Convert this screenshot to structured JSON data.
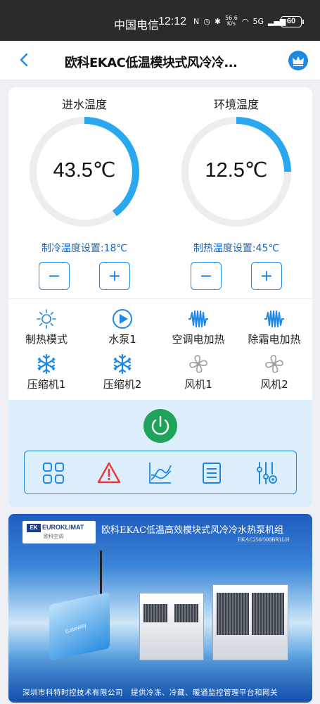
{
  "status_bar": {
    "carrier": "中国电信",
    "time": "12:12",
    "net_speed_value": "56.6",
    "net_speed_unit": "K/s",
    "signal_type": "5G",
    "battery": "60"
  },
  "header": {
    "title": "欧科EKAC低温模块式风冷冷..."
  },
  "gauges": [
    {
      "label": "进水温度",
      "value": "43.5℃",
      "fill_fraction": 0.4,
      "setting": "制冷温度设置:18℃"
    },
    {
      "label": "环境温度",
      "value": "12.5℃",
      "fill_fraction": 0.25,
      "setting": "制热温度设置:45℃"
    }
  ],
  "stepper": {
    "minus": "−",
    "plus": "+"
  },
  "statuses": [
    {
      "label": "制热模式",
      "icon": "sun-icon",
      "active": true
    },
    {
      "label": "水泵1",
      "icon": "pump-icon",
      "active": true
    },
    {
      "label": "空调电加热",
      "icon": "electric-heater-icon",
      "active": true
    },
    {
      "label": "除霜电加热",
      "icon": "electric-heater-icon",
      "active": true
    },
    {
      "label": "压缩机1",
      "icon": "snowflake-icon",
      "active": true
    },
    {
      "label": "压缩机2",
      "icon": "snowflake-icon",
      "active": true
    },
    {
      "label": "风机1",
      "icon": "fan-icon",
      "active": false
    },
    {
      "label": "风机2",
      "icon": "fan-icon",
      "active": false
    }
  ],
  "toolbar": {
    "items": [
      "grid-icon",
      "alarm-icon",
      "trend-chart-icon",
      "list-icon",
      "settings-sliders-icon"
    ]
  },
  "colors": {
    "accent": "#1e88e5",
    "gauge_track": "#ededed",
    "power": "#1fa35a",
    "alarm": "#e53935",
    "inactive": "#9e9e9e"
  },
  "banner": {
    "logo_text": "EUROKLIMAT",
    "logo_abbr": "EK",
    "logo_cn": "欧科空调",
    "headline": "欧科EKAC低温高效模块式风冷冷水热泵机组",
    "model": "EKAC250/500BR1LH",
    "device_label": "Gateway",
    "footer": "深圳市科特时控技术有限公司　提供冷冻、冷藏、暖通监控管理平台和网关"
  }
}
